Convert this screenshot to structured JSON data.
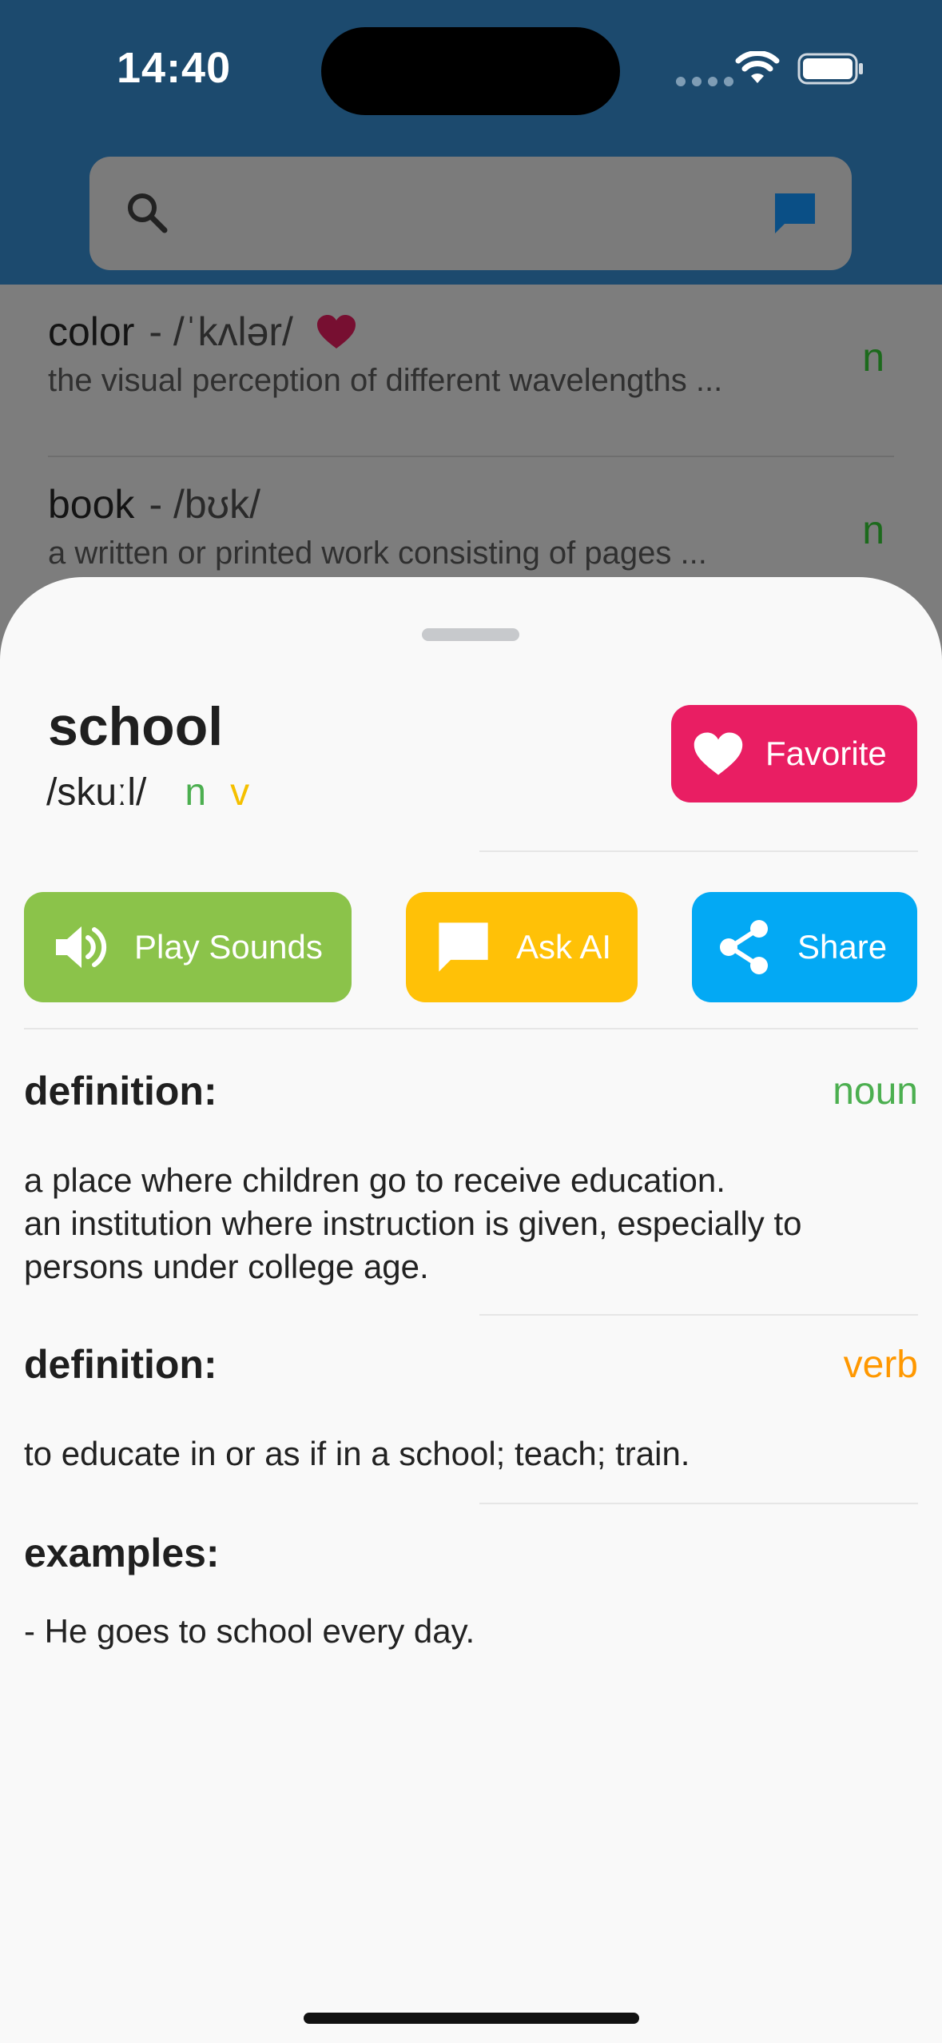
{
  "status_bar": {
    "time": "14:40"
  },
  "search": {
    "placeholder": ""
  },
  "list": [
    {
      "word": "color",
      "pron": "- /ˈkʌlər/",
      "snippet": "the visual perception of different wavelengths ...",
      "pos": "n",
      "favorite": true
    },
    {
      "word": "book",
      "pron": "- /bʊk/",
      "snippet": "a written or printed work consisting of pages ...",
      "pos": "n",
      "favorite": false
    }
  ],
  "detail": {
    "word": "school",
    "phonetic": "/skuːl/",
    "tags": [
      "n",
      "v"
    ],
    "favorite_label": "Favorite",
    "play_label": "Play Sounds",
    "ask_label": "Ask AI",
    "share_label": "Share",
    "definitions": [
      {
        "label": "definition:",
        "pos": "noun",
        "pos_color": "#4caf50",
        "text": "a place where children go to receive education.\nan institution where instruction is given, especially to persons under college age."
      },
      {
        "label": "definition:",
        "pos": "verb",
        "pos_color": "#ff9800",
        "text": "to educate in or as if in a school; teach; train."
      }
    ],
    "examples_label": "examples:",
    "examples": [
      "- He goes to school every day."
    ]
  },
  "colors": {
    "favorite": "#e91e63",
    "play": "#8bc34a",
    "ask": "#ffc107",
    "share": "#03a9f4"
  }
}
